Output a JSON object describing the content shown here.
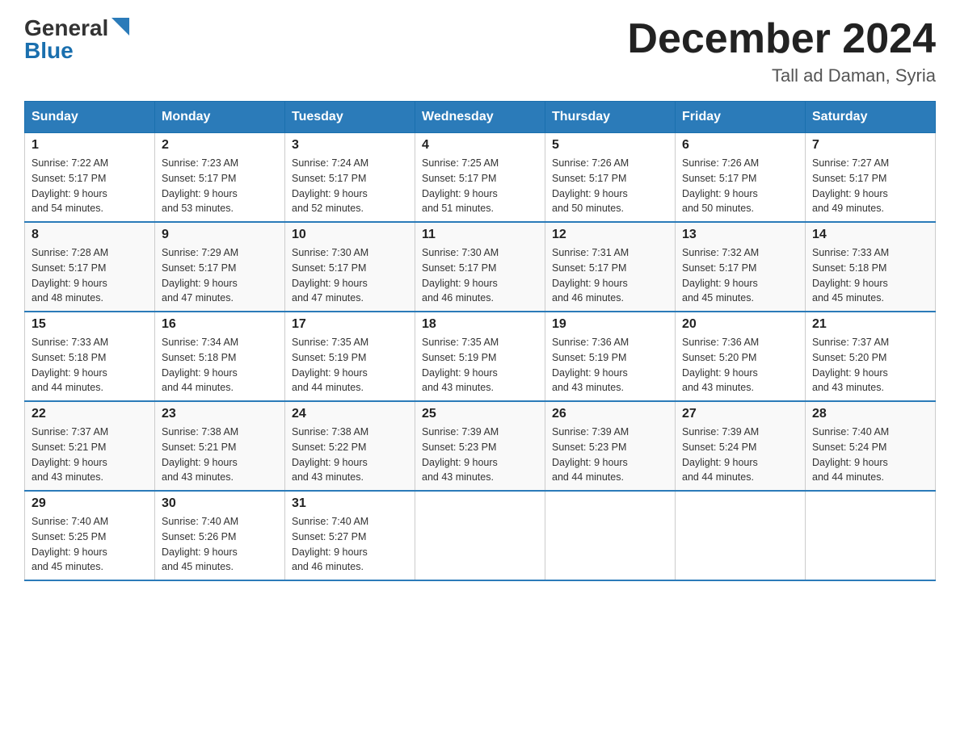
{
  "header": {
    "logo_general": "General",
    "logo_blue": "Blue",
    "month_title": "December 2024",
    "location": "Tall ad Daman, Syria"
  },
  "weekdays": [
    "Sunday",
    "Monday",
    "Tuesday",
    "Wednesday",
    "Thursday",
    "Friday",
    "Saturday"
  ],
  "weeks": [
    [
      {
        "day": "1",
        "sunrise": "7:22 AM",
        "sunset": "5:17 PM",
        "daylight": "9 hours and 54 minutes."
      },
      {
        "day": "2",
        "sunrise": "7:23 AM",
        "sunset": "5:17 PM",
        "daylight": "9 hours and 53 minutes."
      },
      {
        "day": "3",
        "sunrise": "7:24 AM",
        "sunset": "5:17 PM",
        "daylight": "9 hours and 52 minutes."
      },
      {
        "day": "4",
        "sunrise": "7:25 AM",
        "sunset": "5:17 PM",
        "daylight": "9 hours and 51 minutes."
      },
      {
        "day": "5",
        "sunrise": "7:26 AM",
        "sunset": "5:17 PM",
        "daylight": "9 hours and 50 minutes."
      },
      {
        "day": "6",
        "sunrise": "7:26 AM",
        "sunset": "5:17 PM",
        "daylight": "9 hours and 50 minutes."
      },
      {
        "day": "7",
        "sunrise": "7:27 AM",
        "sunset": "5:17 PM",
        "daylight": "9 hours and 49 minutes."
      }
    ],
    [
      {
        "day": "8",
        "sunrise": "7:28 AM",
        "sunset": "5:17 PM",
        "daylight": "9 hours and 48 minutes."
      },
      {
        "day": "9",
        "sunrise": "7:29 AM",
        "sunset": "5:17 PM",
        "daylight": "9 hours and 47 minutes."
      },
      {
        "day": "10",
        "sunrise": "7:30 AM",
        "sunset": "5:17 PM",
        "daylight": "9 hours and 47 minutes."
      },
      {
        "day": "11",
        "sunrise": "7:30 AM",
        "sunset": "5:17 PM",
        "daylight": "9 hours and 46 minutes."
      },
      {
        "day": "12",
        "sunrise": "7:31 AM",
        "sunset": "5:17 PM",
        "daylight": "9 hours and 46 minutes."
      },
      {
        "day": "13",
        "sunrise": "7:32 AM",
        "sunset": "5:17 PM",
        "daylight": "9 hours and 45 minutes."
      },
      {
        "day": "14",
        "sunrise": "7:33 AM",
        "sunset": "5:18 PM",
        "daylight": "9 hours and 45 minutes."
      }
    ],
    [
      {
        "day": "15",
        "sunrise": "7:33 AM",
        "sunset": "5:18 PM",
        "daylight": "9 hours and 44 minutes."
      },
      {
        "day": "16",
        "sunrise": "7:34 AM",
        "sunset": "5:18 PM",
        "daylight": "9 hours and 44 minutes."
      },
      {
        "day": "17",
        "sunrise": "7:35 AM",
        "sunset": "5:19 PM",
        "daylight": "9 hours and 44 minutes."
      },
      {
        "day": "18",
        "sunrise": "7:35 AM",
        "sunset": "5:19 PM",
        "daylight": "9 hours and 43 minutes."
      },
      {
        "day": "19",
        "sunrise": "7:36 AM",
        "sunset": "5:19 PM",
        "daylight": "9 hours and 43 minutes."
      },
      {
        "day": "20",
        "sunrise": "7:36 AM",
        "sunset": "5:20 PM",
        "daylight": "9 hours and 43 minutes."
      },
      {
        "day": "21",
        "sunrise": "7:37 AM",
        "sunset": "5:20 PM",
        "daylight": "9 hours and 43 minutes."
      }
    ],
    [
      {
        "day": "22",
        "sunrise": "7:37 AM",
        "sunset": "5:21 PM",
        "daylight": "9 hours and 43 minutes."
      },
      {
        "day": "23",
        "sunrise": "7:38 AM",
        "sunset": "5:21 PM",
        "daylight": "9 hours and 43 minutes."
      },
      {
        "day": "24",
        "sunrise": "7:38 AM",
        "sunset": "5:22 PM",
        "daylight": "9 hours and 43 minutes."
      },
      {
        "day": "25",
        "sunrise": "7:39 AM",
        "sunset": "5:23 PM",
        "daylight": "9 hours and 43 minutes."
      },
      {
        "day": "26",
        "sunrise": "7:39 AM",
        "sunset": "5:23 PM",
        "daylight": "9 hours and 44 minutes."
      },
      {
        "day": "27",
        "sunrise": "7:39 AM",
        "sunset": "5:24 PM",
        "daylight": "9 hours and 44 minutes."
      },
      {
        "day": "28",
        "sunrise": "7:40 AM",
        "sunset": "5:24 PM",
        "daylight": "9 hours and 44 minutes."
      }
    ],
    [
      {
        "day": "29",
        "sunrise": "7:40 AM",
        "sunset": "5:25 PM",
        "daylight": "9 hours and 45 minutes."
      },
      {
        "day": "30",
        "sunrise": "7:40 AM",
        "sunset": "5:26 PM",
        "daylight": "9 hours and 45 minutes."
      },
      {
        "day": "31",
        "sunrise": "7:40 AM",
        "sunset": "5:27 PM",
        "daylight": "9 hours and 46 minutes."
      },
      null,
      null,
      null,
      null
    ]
  ],
  "labels": {
    "sunrise": "Sunrise:",
    "sunset": "Sunset:",
    "daylight": "Daylight:"
  }
}
